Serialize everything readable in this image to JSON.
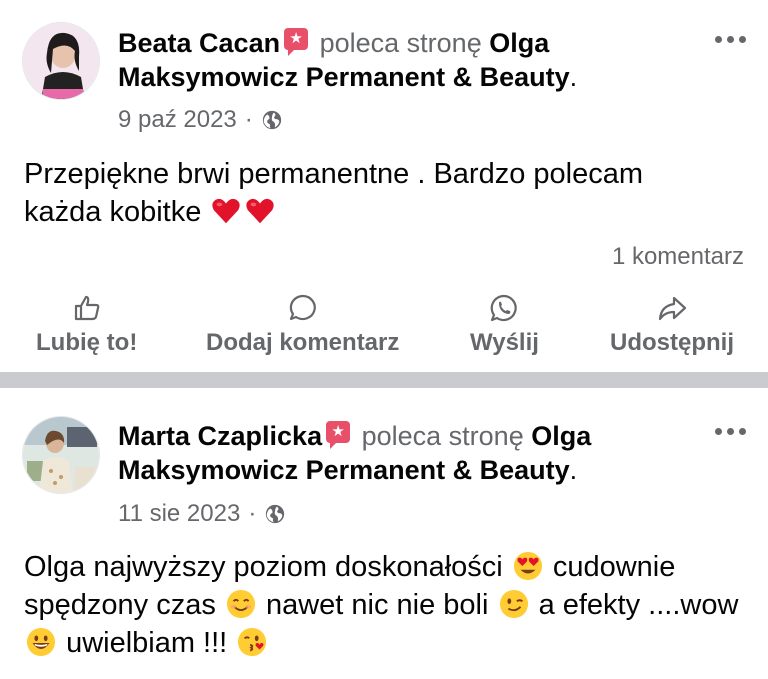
{
  "posts": [
    {
      "author": "Beata Cacan",
      "verb": "poleca stronę",
      "page": "Olga Maksymowicz Permanent & Beauty",
      "period": ".",
      "date": "9 paź 2023",
      "separator": "·",
      "text_line1": "Przepiękne brwi permanentne . Bardzo polecam",
      "text_line2": "każda kobitke",
      "comment_count": "1 komentarz",
      "actions": {
        "like": "Lubię to!",
        "comment": "Dodaj komentarz",
        "send": "Wyślij",
        "share": "Udostępnij"
      }
    },
    {
      "author": "Marta Czaplicka",
      "verb": "poleca stronę",
      "page": "Olga Maksymowicz Permanent & Beauty",
      "period": ".",
      "date": "11 sie 2023",
      "separator": "·",
      "text_part1": "Olga najwyższy poziom doskonałości",
      "text_part2": "cudownie spędzony czas",
      "text_part3": "nawet nic nie boli",
      "text_part4": "a efekty ....wow",
      "text_part5": "uwielbiam !!!"
    }
  ],
  "colors": {
    "secondary_text": "#65676b",
    "badge": "#e8506a",
    "divider": "#cacbcf"
  },
  "icons": [
    "more-options-icon",
    "globe-icon",
    "heart-emoji-icon",
    "like-icon",
    "comment-icon",
    "whatsapp-icon",
    "share-icon",
    "heart-eyes-emoji-icon",
    "smiling-emoji-icon",
    "wink-emoji-icon",
    "grin-emoji-icon",
    "kiss-emoji-icon"
  ]
}
